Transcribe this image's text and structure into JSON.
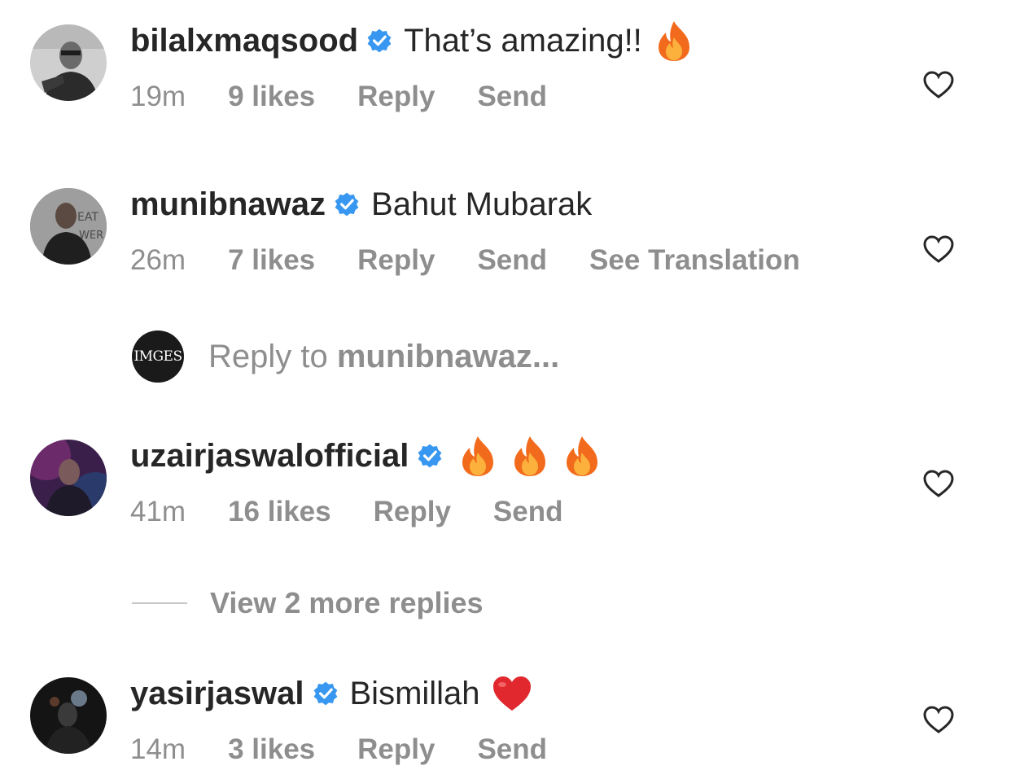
{
  "comments": [
    {
      "username": "bilalxmaqsood",
      "text": "That’s amazing!!",
      "emojis": [
        "fire-emoji"
      ],
      "time": "19m",
      "likes": "9 likes",
      "reply": "Reply",
      "send": "Send"
    },
    {
      "username": "munibnawaz",
      "text": "Bahut Mubarak",
      "emojis": [],
      "time": "26m",
      "likes": "7 likes",
      "reply": "Reply",
      "send": "Send",
      "translation": "See Translation"
    },
    {
      "username": "uzairjaswalofficial",
      "text": "",
      "emojis": [
        "fire-emoji",
        "fire-emoji",
        "fire-emoji"
      ],
      "time": "41m",
      "likes": "16 likes",
      "reply": "Reply",
      "send": "Send"
    },
    {
      "username": "yasirjaswal",
      "text": "Bismillah",
      "emojis": [
        "heart-emoji"
      ],
      "time": "14m",
      "likes": "3 likes",
      "reply": "Reply",
      "send": "Send"
    }
  ],
  "reply_prompt": {
    "avatar_text": "IMGES",
    "prefix": "Reply to ",
    "target": "munibnawaz..."
  },
  "view_more": "View 2 more replies",
  "colors": {
    "text": "#262626",
    "muted": "#8e8e8e",
    "verified": "#3897f0"
  },
  "icons": {
    "verified": "verified-badge-icon",
    "like": "heart-outline-icon"
  }
}
